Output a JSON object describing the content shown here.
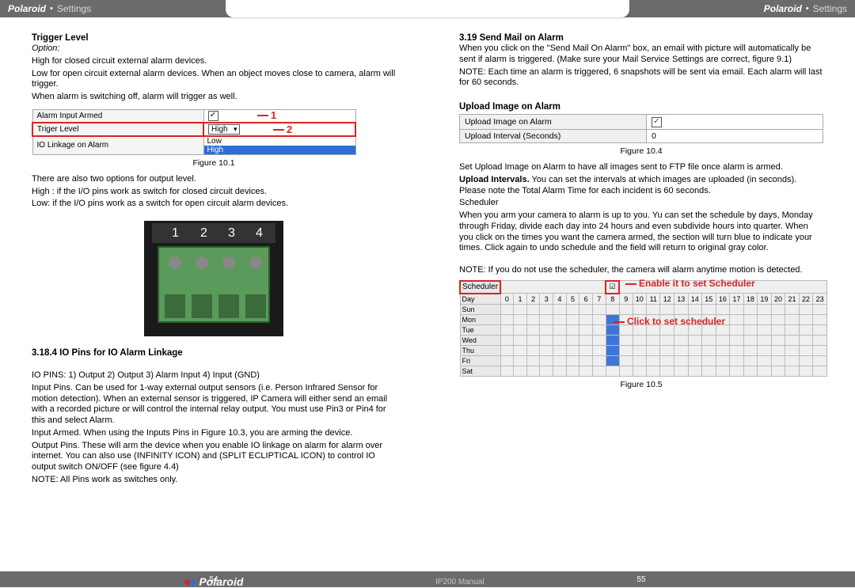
{
  "header": {
    "brand": "Polaroid",
    "section": "Settings"
  },
  "left": {
    "trigger_title": "Trigger Level",
    "option_label": "Option:",
    "p1": "High for closed circuit external alarm devices.",
    "p2": "Low for open circuit external alarm devices. When an object moves close to camera, alarm will trigger.",
    "p3": "When alarm is switching off, alarm will trigger as well.",
    "fig101": {
      "row1_label": "Alarm Input Armed",
      "row2_label": "Triger Level",
      "row2_value": "High",
      "row3_label": "IO Linkage on Alarm",
      "row3_low": "Low",
      "row3_high": "High",
      "callout1": "1",
      "callout2": "2"
    },
    "fig101_caption": "Figure 10.1",
    "p4": "There are also two options for output level.",
    "p5": "High : if the I/O pins work as switch for closed circuit devices.",
    "p6": "Low: if the I/O pins work as a switch for open circuit alarm devices.",
    "terminal_labels": [
      "1",
      "2",
      "3",
      "4"
    ],
    "iopins_title": "3.18.4 IO Pins for IO Alarm Linkage",
    "p7": "IO PINS: 1) Output 2) Output 3) Alarm Input 4) Input (GND)",
    "p8": "Input Pins. Can be used for 1-way external output sensors (i.e. Person Infrared Sensor for motion detection). When an external sensor is triggered, IP Camera will either send an email with a recorded picture or will control the internal relay output. You must use Pin3 or Pin4 for this and select Alarm.",
    "p9": "Input Armed. When using the Inputs Pins in Figure 10.3, you are arming the device.",
    "p10": "Output Pins. These will arm the device when you enable IO linkage on alarm for alarm over internet. You can also use (INFINITY ICON) and (SPLIT ECLIPTICAL ICON) to control IO output switch ON/OFF (see figure 4.4)",
    "p11": "NOTE: All Pins work as switches only."
  },
  "right": {
    "sendmail_title": "3.19 Send Mail on Alarm",
    "p1": "When you click on the \"Send Mail On Alarm\" box, an email with picture will automatically be sent if alarm is triggered. (Make sure your Mail Service Settings are correct, figure 9.1)",
    "p2": "NOTE: Each time an alarm is triggered, 6 snapshots will be sent via email. Each alarm will last for 60 seconds.",
    "upload_title": "Upload Image on Alarm",
    "fig104": {
      "row1_label": "Upload Image on Alarm",
      "row2_label": "Upload Interval (Seconds)",
      "row2_value": "0"
    },
    "fig104_caption": "Figure 10.4",
    "p3": "Set Upload Image on Alarm to have all images sent to FTP file once alarm is armed.",
    "p4_bold": "Upload Intervals.",
    "p4": " You can set the intervals at which images are uploaded (in seconds). Please note the Total Alarm Time for each incident is 60 seconds.",
    "p5": "Scheduler",
    "p6": "When you arm your camera to alarm is up to you. Yu can set the schedule by days, Monday through Friday, divide each day into 24 hours and even subdivide hours into quarter. When you click on the times you want the camera armed, the section will turn blue to indicate your times. Click again to undo schedule and the field will return to original gray color.",
    "p7": "NOTE: If you do not use the scheduler, the camera will alarm anytime motion is detected.",
    "fig105": {
      "scheduler_label": "Scheduler",
      "callout1": "Enable it to set Scheduler",
      "callout2": "Click to set scheduler",
      "day_header": "Day",
      "hours": [
        "0",
        "1",
        "2",
        "3",
        "4",
        "5",
        "6",
        "7",
        "8",
        "9",
        "10",
        "11",
        "12",
        "13",
        "14",
        "15",
        "16",
        "17",
        "18",
        "19",
        "20",
        "21",
        "22",
        "23"
      ],
      "days": [
        "Sun",
        "Mon",
        "Tue",
        "Wed",
        "Thu",
        "Fri",
        "Sat"
      ]
    },
    "fig105_caption": "Figure 10.5"
  },
  "footer": {
    "page_left": "54",
    "page_right": "55",
    "manual": "IP200 Manual",
    "logo": "Polaroid"
  }
}
